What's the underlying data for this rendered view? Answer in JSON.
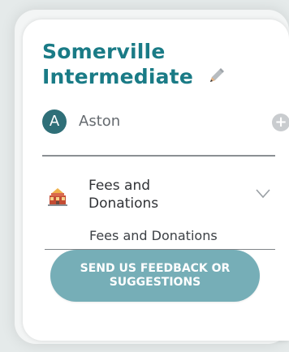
{
  "school": {
    "name": "Somerville Intermediate",
    "accent": "#1a7b86"
  },
  "student": {
    "initial": "A",
    "name": "Aston",
    "avatar_color": "#2f6f78",
    "add_icon": "+",
    "add_icon_name": "plus-circle-icon"
  },
  "fees": {
    "title": "Fees and Donations",
    "subtitle": "Fees and Donations",
    "icon": "school-building-icon",
    "expand_icon": "chevron-down-icon"
  },
  "feedback": {
    "label": "SEND US FEEDBACK OR SUGGESTIONS",
    "color": "#76aeb7"
  }
}
